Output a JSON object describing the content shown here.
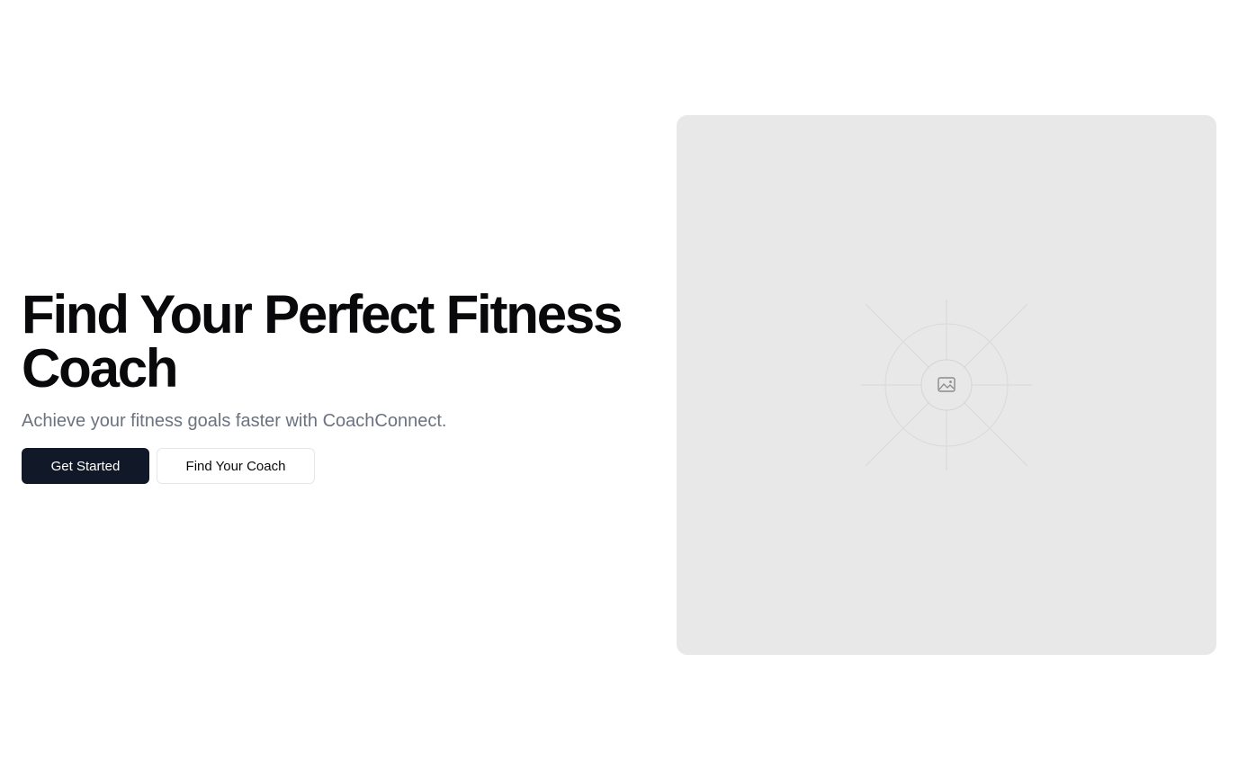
{
  "hero": {
    "headline": "Find Your Perfect Fitness Coach",
    "subtitle": "Achieve your fitness goals faster with CoachConnect.",
    "primary_button": "Get Started",
    "secondary_button": "Find Your Coach"
  },
  "image": {
    "icon": "image-placeholder-icon"
  },
  "colors": {
    "primary_button_bg": "#111827",
    "headline": "#09090b",
    "subtitle": "#6b7280",
    "placeholder_bg": "#e8e8e8"
  }
}
